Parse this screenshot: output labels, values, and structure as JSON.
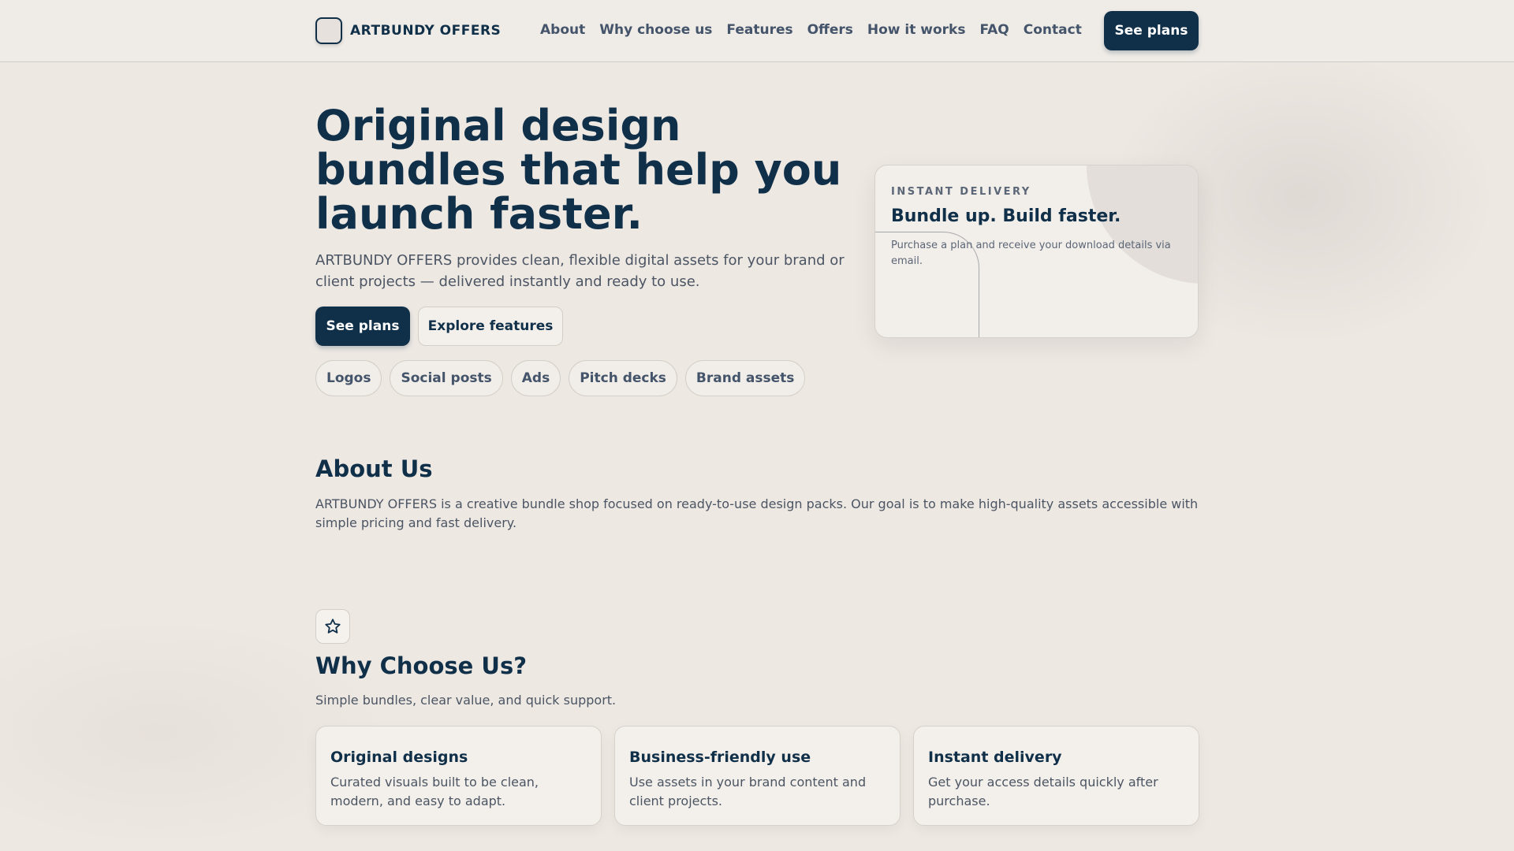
{
  "brand": {
    "name": "ARTBUNDY OFFERS"
  },
  "nav": {
    "items": [
      "About",
      "Why choose us",
      "Features",
      "Offers",
      "How it works",
      "FAQ",
      "Contact"
    ],
    "cta": "See plans"
  },
  "hero": {
    "title": "Original design bundles that help you launch faster.",
    "subtitle": "ARTBUNDY OFFERS provides clean, flexible digital assets for your brand or client projects — delivered instantly and ready to use.",
    "primary_cta": "See plans",
    "secondary_cta": "Explore features",
    "chips": [
      "Logos",
      "Social posts",
      "Ads",
      "Pitch decks",
      "Brand assets"
    ]
  },
  "hero_card": {
    "eyebrow": "INSTANT DELIVERY",
    "title": "Bundle up. Build faster.",
    "text": "Purchase a plan and receive your download details via email."
  },
  "about": {
    "title": "About Us",
    "text": "ARTBUNDY OFFERS is a creative bundle shop focused on ready-to-use design packs. Our goal is to make high-quality assets accessible with simple pricing and fast delivery."
  },
  "why": {
    "icon": "star-icon",
    "title": "Why Choose Us?",
    "subtitle": "Simple bundles, clear value, and quick support.",
    "cards": [
      {
        "title": "Original designs",
        "text": "Curated visuals built to be clean, modern, and easy to adapt."
      },
      {
        "title": "Business-friendly use",
        "text": "Use assets in your brand content and client projects."
      },
      {
        "title": "Instant delivery",
        "text": "Get your access details quickly after purchase."
      }
    ]
  },
  "colors": {
    "primary": "#10304a",
    "background": "#eee8e3",
    "muted_text": "#4b5563"
  }
}
